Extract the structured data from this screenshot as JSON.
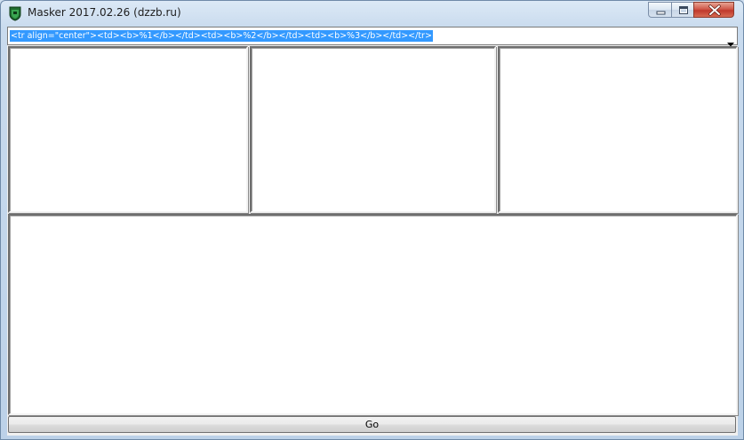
{
  "window": {
    "title": "Masker 2017.02.26 (dzzb.ru)",
    "icon": "masker-shield-icon"
  },
  "template_combo": {
    "value": "<tr align=\"center\"><td><b>%1</b></td><td><b>%2</b></td><td><b>%3</b></td></tr>"
  },
  "actions": {
    "go_label": "Go"
  },
  "colors": {
    "selection": "#3399ff",
    "close_button": "#c0392b"
  }
}
